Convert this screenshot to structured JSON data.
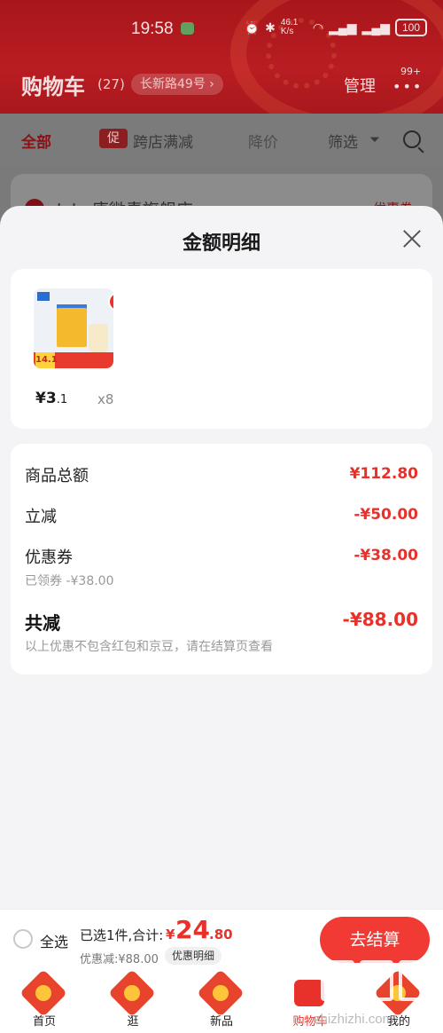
{
  "status_bar": {
    "time": "19:58",
    "network_speed": "46.1 K/s",
    "battery": "100"
  },
  "header": {
    "title": "购物车",
    "count": "(27)",
    "address": "长新路49号 ›",
    "manage_label": "管理",
    "more_badge": "99+"
  },
  "filters": {
    "all": "全部",
    "promo_tag": "促",
    "cross_store": "跨店满减",
    "price_drop": "降价",
    "filter": "筛选"
  },
  "store": {
    "name": "lala 唐微青旗舰店 ›",
    "coupon_label": "优惠券"
  },
  "sheet": {
    "title": "金额明细",
    "product": {
      "badge": "14.1",
      "price_symbol": "¥",
      "price_int": "3",
      "price_dec": ".1",
      "quantity": "x8"
    },
    "details": {
      "goods_total_label": "商品总额",
      "goods_total_value": "¥112.80",
      "instant_cut_label": "立减",
      "instant_cut_value": "-¥50.00",
      "coupon_label": "优惠券",
      "coupon_value": "-¥38.00",
      "coupon_sub": "已领券 -¥38.00",
      "total_cut_label": "共减",
      "total_cut_value": "-¥88.00",
      "note": "以上优惠不包含红包和京豆，请在结算页查看"
    }
  },
  "checkout": {
    "select_all": "全选",
    "selected_text": "已选1件,合计:",
    "total_currency": "¥",
    "total_int": "24",
    "total_dec": ".80",
    "discount": "优惠减:¥88.00",
    "detail_chip": "优惠明细",
    "button": "去结算"
  },
  "bottom_nav": {
    "items": [
      {
        "label": "首页",
        "icon": "home-icon"
      },
      {
        "label": "逛",
        "icon": "browse-icon"
      },
      {
        "label": "新品",
        "icon": "new-icon"
      },
      {
        "label": "购物车",
        "icon": "cart-icon"
      },
      {
        "label": "我的",
        "icon": "profile-icon"
      }
    ]
  },
  "watermark": "zhizhizhi.com"
}
